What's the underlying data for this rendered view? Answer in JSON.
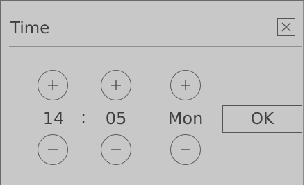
{
  "dialog": {
    "title": "Time",
    "close_icon": "close-icon"
  },
  "time": {
    "hour": "14",
    "separator": ":",
    "minute": "05",
    "day": "Mon"
  },
  "controls": {
    "increment_icon": "plus-icon",
    "decrement_icon": "minus-icon"
  },
  "buttons": {
    "ok_label": "OK"
  },
  "colors": {
    "dialog_background": "#c9c8c9",
    "text": "#404040",
    "border": "#555555"
  }
}
